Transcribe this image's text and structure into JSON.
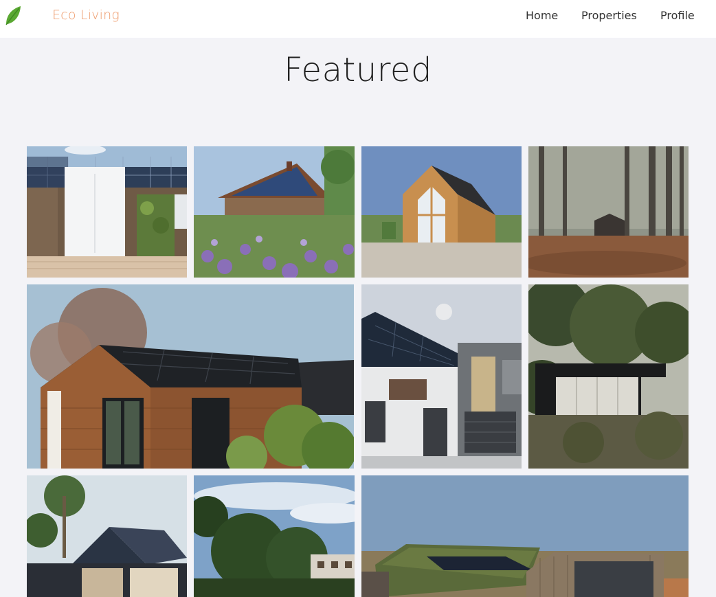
{
  "navbar": {
    "brand": "Eco Living",
    "logo_icon": "leaf-icon",
    "links": [
      "Home",
      "Properties",
      "Profile"
    ]
  },
  "page": {
    "title": "Featured"
  },
  "gallery": {
    "tiles": [
      "Solar-roof house with white double door and green wall",
      "Wooden house with solar roof behind purple wildflowers",
      "Small timber A-frame cabin with glass front",
      "Small dark cabin in misty autumn forest",
      "Timber-clad tiny house with black solar panel roof",
      "Modern grey house with solar roof and front gate",
      "Dark modern pavilion house among forest trees",
      "Dark gabled house with solar roof and palm trees",
      "Trees and houses under cloudy sky",
      "Timber house with green living roof and skylight"
    ]
  },
  "colors": {
    "brand": "#ee9a6a",
    "leaf": "#5aa832",
    "background": "#f3f3f7"
  }
}
